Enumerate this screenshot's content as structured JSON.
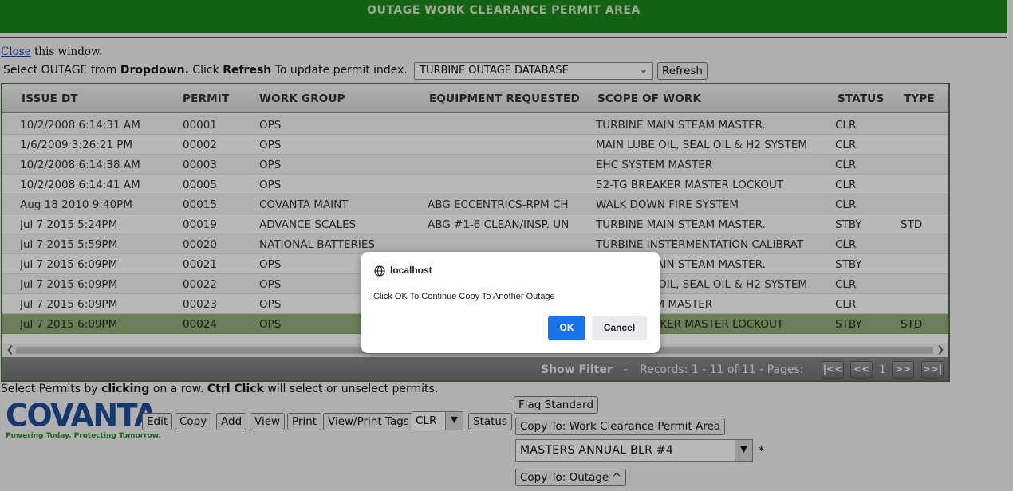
{
  "banner": {
    "title": "OUTAGE WORK CLEARANCE PERMIT AREA"
  },
  "close_line": {
    "link": "Close",
    "rest": "this window."
  },
  "instruction": {
    "part1": "Select OUTAGE from ",
    "bold1": "Dropdown.",
    "part2": " Click ",
    "bold2": "Refresh",
    "part3": " To update permit index."
  },
  "outage_select": {
    "value": "TURBINE OUTAGE DATABASE"
  },
  "refresh_button": "Refresh",
  "grid": {
    "columns": [
      "ISSUE DT",
      "PERMIT",
      "WORK GROUP",
      "EQUIPMENT REQUESTED",
      "SCOPE OF WORK",
      "STATUS",
      "TYPE"
    ],
    "rows": [
      [
        "10/2/2008 6:14:31 AM",
        "00001",
        "OPS",
        "",
        "TURBINE MAIN STEAM MASTER.",
        "CLR",
        ""
      ],
      [
        "1/6/2009 3:26:21 PM",
        "00002",
        "OPS",
        "",
        "MAIN LUBE OIL, SEAL OIL & H2 SYSTEM",
        "CLR",
        ""
      ],
      [
        "10/2/2008 6:14:38 AM",
        "00003",
        "OPS",
        "",
        "EHC SYSTEM MASTER",
        "CLR",
        ""
      ],
      [
        "10/2/2008 6:14:41 AM",
        "00005",
        "OPS",
        "",
        "52-TG BREAKER MASTER LOCKOUT",
        "CLR",
        ""
      ],
      [
        "Aug 18 2010 9:40PM",
        "00015",
        "COVANTA MAINT",
        "ABG ECCENTRICS-RPM CH",
        "WALK DOWN FIRE SYSTEM",
        "CLR",
        ""
      ],
      [
        "Jul 7 2015 5:24PM",
        "00019",
        "ADVANCE SCALES",
        "ABG #1-6 CLEAN/INSP. UN",
        "TURBINE MAIN STEAM MASTER.",
        "STBY",
        "STD"
      ],
      [
        "Jul 7 2015 5:59PM",
        "00020",
        "NATIONAL BATTERIES",
        "",
        "TURBINE INSTERMENTATION CALIBRAT",
        "CLR",
        ""
      ],
      [
        "Jul 7 2015 6:09PM",
        "00021",
        "OPS",
        "",
        "TURBINE MAIN STEAM MASTER.",
        "STBY",
        ""
      ],
      [
        "Jul 7 2015 6:09PM",
        "00022",
        "OPS",
        "",
        "MAIN LUBE OIL, SEAL OIL & H2 SYSTEM",
        "CLR",
        ""
      ],
      [
        "Jul 7 2015 6:09PM",
        "00023",
        "OPS",
        "",
        "EHC SYSTEM MASTER",
        "CLR",
        ""
      ],
      [
        "Jul 7 2015 6:09PM",
        "00024",
        "OPS",
        "",
        "52-TG BREAKER MASTER LOCKOUT",
        "STBY",
        "STD"
      ]
    ],
    "selected_row": 10
  },
  "footer": {
    "show_filter": "Show Filter",
    "dash": "-",
    "records": "Records: 1 - 11 of 11 - Pages:",
    "page": "1",
    "first_label": "|<<",
    "prev_label": "<<",
    "next_label": ">>",
    "last_label": ">>|"
  },
  "select_hint": {
    "part1": "Select Permits by ",
    "bold1": "clicking",
    "part2": " on a row. ",
    "bold2": "Ctrl Click",
    "part3": " will select or unselect permits."
  },
  "logo": {
    "word": "COVANTA",
    "tagline": "Powering Today. Protecting Tomorrow."
  },
  "toolbar": {
    "edit": "Edit",
    "copy": "Copy",
    "add": "Add",
    "view": "View",
    "print": "Print",
    "view_print_tags": "View/Print Tags",
    "status_value": "CLR",
    "status": "Status",
    "flag_standard": "Flag Standard",
    "copy_to_wcpa": "Copy To: Work Clearance Permit Area",
    "masters_value": "MASTERS ANNUAL BLR #4",
    "required_star": "*",
    "copy_to_outage": "Copy To: Outage ^"
  },
  "dialog": {
    "title": "localhost",
    "message": "Click OK To Continue Copy To Another Outage",
    "ok": "OK",
    "cancel": "Cancel"
  },
  "colors": {
    "banner": "#1c8a1c",
    "selected_row": "#93b07c",
    "ok_button": "#1a73e8"
  }
}
